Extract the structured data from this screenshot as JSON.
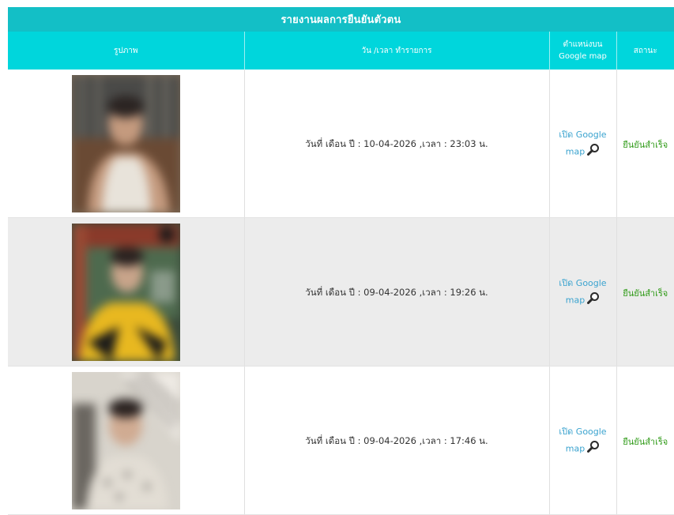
{
  "report": {
    "title": "รายงานผลการยืนยันตัวตน",
    "columns": [
      "รูปภาพ",
      "วัน /เวลา ทำรายการ",
      "ตำแหน่งบน Google map",
      "สถานะ"
    ]
  },
  "rows": [
    {
      "datetime": "วันที่ เดือน ปี : 10-04-2026 ,เวลา : 23:03 น.",
      "map_link": "เปิด Google map",
      "status": "ยืนยันสำเร็จ"
    },
    {
      "datetime": "วันที่ เดือน ปี : 09-04-2026 ,เวลา : 19:26 น.",
      "map_link": "เปิด Google map",
      "status": "ยืนยันสำเร็จ"
    },
    {
      "datetime": "วันที่ เดือน ปี : 09-04-2026 ,เวลา : 17:46 น.",
      "map_link": "เปิด Google map",
      "status": "ยืนยันสำเร็จ"
    }
  ],
  "icons": {
    "map_link_icon": "magnifier-icon"
  },
  "colors": {
    "title_bar": "#13bfc6",
    "header_bar": "#00d6dc",
    "link": "#3aa3cf",
    "status_success": "#2e9a16",
    "row_alt": "#ececec"
  }
}
